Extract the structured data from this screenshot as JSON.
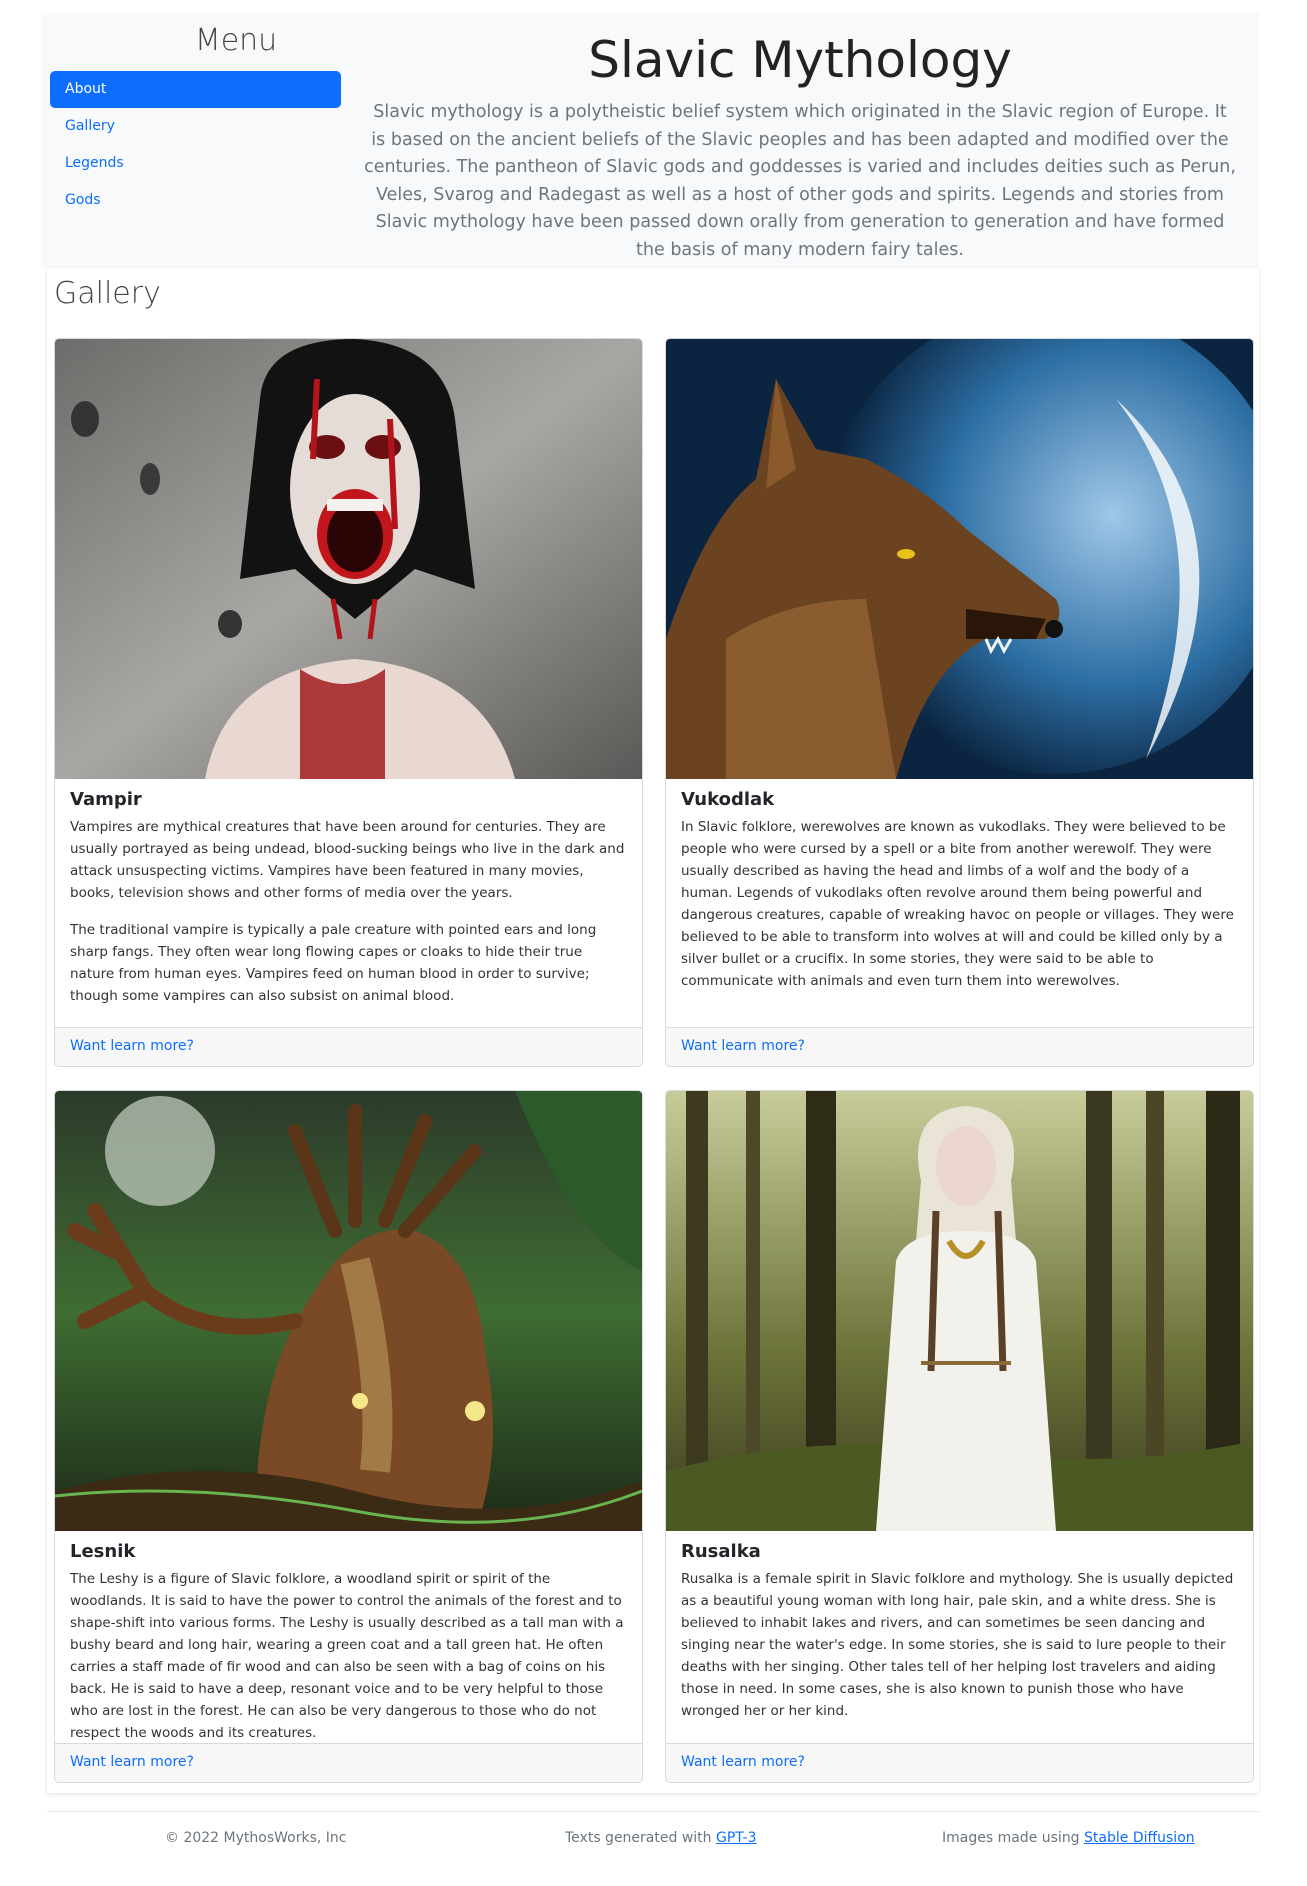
{
  "menu": {
    "title": "Menu",
    "items": [
      {
        "label": "About",
        "active": true
      },
      {
        "label": "Gallery",
        "active": false
      },
      {
        "label": "Legends",
        "active": false
      },
      {
        "label": "Gods",
        "active": false
      }
    ]
  },
  "header": {
    "title": "Slavic Mythology",
    "intro": "Slavic mythology is a polytheistic belief system which originated in the Slavic region of Europe. It is based on the ancient beliefs of the Slavic peoples and has been adapted and modified over the centuries. The pantheon of Slavic gods and goddesses is varied and includes deities such as Perun, Veles, Svarog and Radegast as well as a host of other gods and spirits. Legends and stories from Slavic mythology have been passed down orally from generation to generation and have formed the basis of many modern fairy tales."
  },
  "gallery": {
    "heading": "Gallery",
    "cards": [
      {
        "title": "Vampir",
        "image": "vampire-woman-image",
        "paragraphs": [
          "Vampires are mythical creatures that have been around for centuries. They are usually portrayed as being undead, blood-sucking beings who live in the dark and attack unsuspecting victims. Vampires have been featured in many movies, books, television shows and other forms of media over the years.",
          "The traditional vampire is typically a pale creature with pointed ears and long sharp fangs. They often wear long flowing capes or cloaks to hide their true nature from human eyes. Vampires feed on human blood in order to survive; though some vampires can also subsist on animal blood."
        ],
        "link": "Want learn more?"
      },
      {
        "title": "Vukodlak",
        "image": "werewolf-moon-image",
        "paragraphs": [
          "In Slavic folklore, werewolves are known as vukodlaks. They were believed to be people who were cursed by a spell or a bite from another werewolf. They were usually described as having the head and limbs of a wolf and the body of a human. Legends of vukodlaks often revolve around them being powerful and dangerous creatures, capable of wreaking havoc on people or villages. They were believed to be able to transform into wolves at will and could be killed only by a silver bullet or a crucifix. In some stories, they were said to be able to communicate with animals and even turn them into werewolves."
        ],
        "link": "Want learn more?"
      },
      {
        "title": "Lesnik",
        "image": "forest-spirit-image",
        "paragraphs": [
          "The Leshy is a figure of Slavic folklore, a woodland spirit or spirit of the woodlands. It is said to have the power to control the animals of the forest and to shape-shift into various forms. The Leshy is usually described as a tall man with a bushy beard and long hair, wearing a green coat and a tall green hat. He often carries a staff made of fir wood and can also be seen with a bag of coins on his back. He is said to have a deep, resonant voice and to be very helpful to those who are lost in the forest. He can also be very dangerous to those who do not respect the woods and its creatures."
        ],
        "link": "Want learn more?"
      },
      {
        "title": "Rusalka",
        "image": "forest-maiden-image",
        "paragraphs": [
          "Rusalka is a female spirit in Slavic folklore and mythology. She is usually depicted as a beautiful young woman with long hair, pale skin, and a white dress. She is believed to inhabit lakes and rivers, and can sometimes be seen dancing and singing near the water's edge. In some stories, she is said to lure people to their deaths with her singing. Other tales tell of her helping lost travelers and aiding those in need. In some cases, she is also known to punish those who have wronged her or her kind."
        ],
        "link": "Want learn more?"
      }
    ]
  },
  "footer": {
    "copyright": "© 2022 MythosWorks, Inc",
    "texts_prefix": "Texts generated with ",
    "texts_link": "GPT-3",
    "images_prefix": "Images made using ",
    "images_link": "Stable Diffusion"
  }
}
